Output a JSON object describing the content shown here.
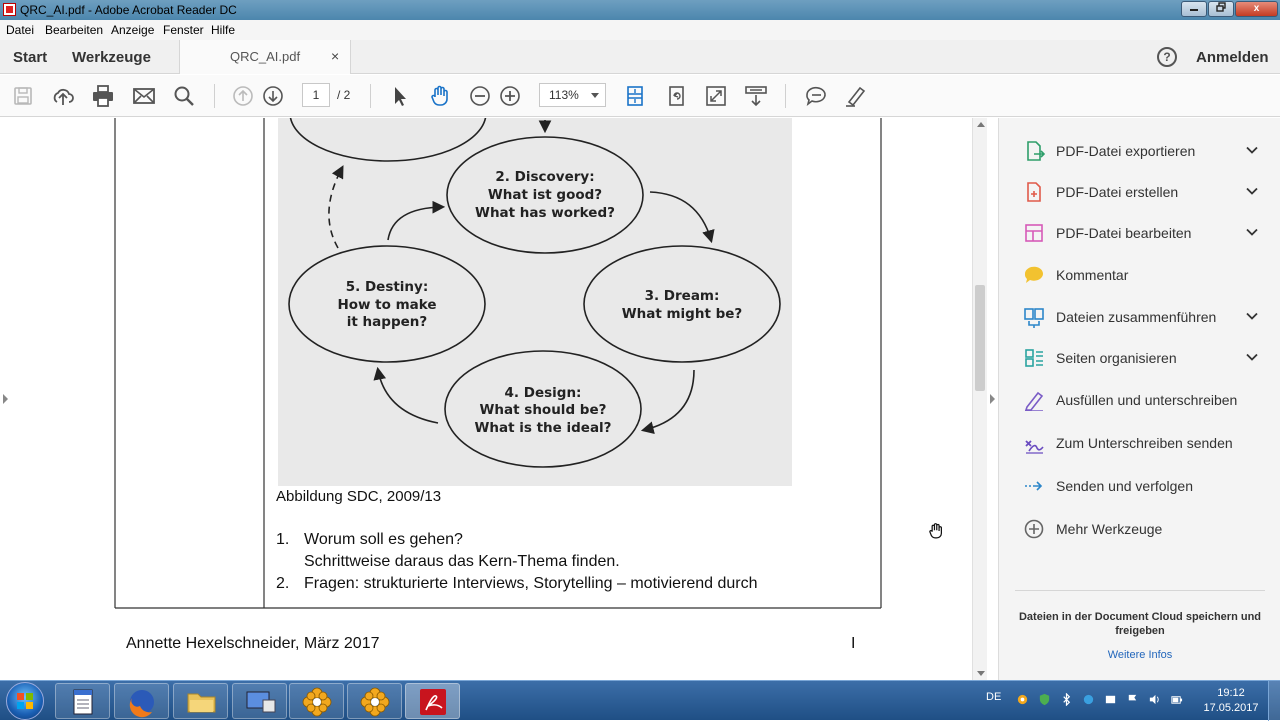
{
  "window": {
    "title": "QRC_AI.pdf - Adobe Acrobat Reader DC",
    "minimize_icon": "minimize-icon",
    "maximize_icon": "restore-icon",
    "close_label": "x"
  },
  "menu": {
    "items": [
      "Datei",
      "Bearbeiten",
      "Anzeige",
      "Fenster",
      "Hilfe"
    ]
  },
  "tabs": {
    "start": "Start",
    "tools": "Werkzeuge",
    "document": "QRC_AI.pdf",
    "close": "×",
    "help": "?",
    "signin": "Anmelden"
  },
  "toolbar": {
    "page_current": "1",
    "page_total": "/  2",
    "zoom": "113%"
  },
  "document": {
    "diagram": {
      "node_top_arrow": "",
      "discovery": [
        "2. Discovery:",
        "What ist good?",
        "What has worked?"
      ],
      "dream": [
        "3. Dream:",
        "What might be?"
      ],
      "design": [
        "4. Design:",
        "What should be?",
        "What is the ideal?"
      ],
      "destiny": [
        "5. Destiny:",
        "How to make",
        "it happen?"
      ]
    },
    "caption": "Abbildung SDC, 2009/13",
    "list": [
      {
        "num": "1.",
        "line1": "Worum soll es gehen?",
        "line2": "Schrittweise daraus das Kern-Thema finden."
      },
      {
        "num": "2.",
        "line1": "Fragen: strukturierte Interviews, Storytelling – motivierend durch",
        "line2": ""
      }
    ],
    "footer_author": "Annette Hexelschneider, März 2017",
    "footer_page": "I"
  },
  "right_pane": {
    "tools": [
      {
        "label": "PDF-Datei exportieren",
        "icon": "export-pdf-icon",
        "color": "#2e9e6a",
        "expand": true
      },
      {
        "label": "PDF-Datei erstellen",
        "icon": "create-pdf-icon",
        "color": "#e05a4a",
        "expand": true
      },
      {
        "label": "PDF-Datei bearbeiten",
        "icon": "edit-pdf-icon",
        "color": "#d65ab8",
        "expand": true
      },
      {
        "label": "Kommentar",
        "icon": "comment-icon",
        "color": "#f2c230",
        "expand": false
      },
      {
        "label": "Dateien zusammenführen",
        "icon": "combine-files-icon",
        "color": "#2c86c9",
        "expand": true
      },
      {
        "label": "Seiten organisieren",
        "icon": "organize-pages-icon",
        "color": "#2aa3a0",
        "expand": true
      },
      {
        "label": "Ausfüllen und unterschreiben",
        "icon": "fill-sign-icon",
        "color": "#7a5cc6",
        "expand": false
      },
      {
        "label": "Zum Unterschreiben senden",
        "icon": "send-for-signature-icon",
        "color": "#6a4cc0",
        "expand": false
      },
      {
        "label": "Senden und verfolgen",
        "icon": "send-track-icon",
        "color": "#2c86c9",
        "expand": false
      },
      {
        "label": "Mehr Werkzeuge",
        "icon": "more-tools-icon",
        "color": "#666666",
        "expand": false
      }
    ],
    "cloud_text": "Dateien in der Document Cloud speichern und freigeben",
    "cloud_link": "Weitere Infos"
  },
  "taskbar": {
    "language": "DE",
    "time": "19:12",
    "date": "17.05.2017"
  }
}
